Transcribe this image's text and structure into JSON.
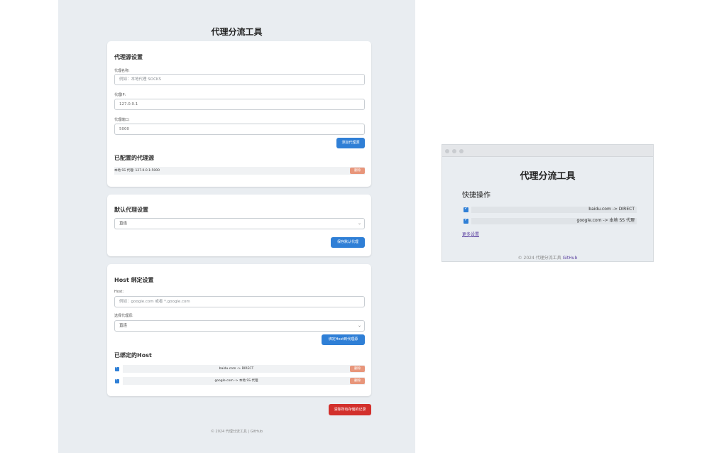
{
  "settings": {
    "title": "代理分流工具",
    "proxy_server": {
      "heading": "代理源设置",
      "name_label": "代理名称:",
      "name_placeholder": "例如：本地代理 SOCKS",
      "ip_label": "代理IP:",
      "ip_value": "127.0.0.1",
      "port_label": "代理端口:",
      "port_value": "5000",
      "add_button": "添加代理源",
      "configured_heading": "已配置的代理源",
      "configured_items": [
        {
          "text": "本地 SS 代理: 127.0.0.1:5000",
          "delete": "删除"
        }
      ]
    },
    "default_proxy": {
      "heading": "默认代理设置",
      "select_value": "直连",
      "save_button": "保存默认代理"
    },
    "host_binding": {
      "heading": "Host 绑定设置",
      "host_label": "Host:",
      "host_placeholder": "例如：google.com 或者 *.google.com",
      "select_label": "选择代理源:",
      "select_value": "直连",
      "bind_button": "绑定Host到代理源",
      "bound_heading": "已绑定的Host",
      "bound_items": [
        {
          "text": "baidu.com -> DIRECT",
          "delete": "删除"
        },
        {
          "text": "google.com -> 本地 SS 代理",
          "delete": "删除"
        }
      ]
    },
    "clear_button": "清除所有存储的记录",
    "footer": "© 2024 代理分流工具 | GitHub"
  },
  "popup": {
    "title": "代理分流工具",
    "section": "快捷操作",
    "rows": [
      {
        "text": "baidu.com -> DIRECT"
      },
      {
        "text": "google.com -> 本地 SS 代理"
      }
    ],
    "more_link": "更多设置",
    "footer_text": "© 2024 代理分流工具",
    "footer_link": "GitHub"
  }
}
